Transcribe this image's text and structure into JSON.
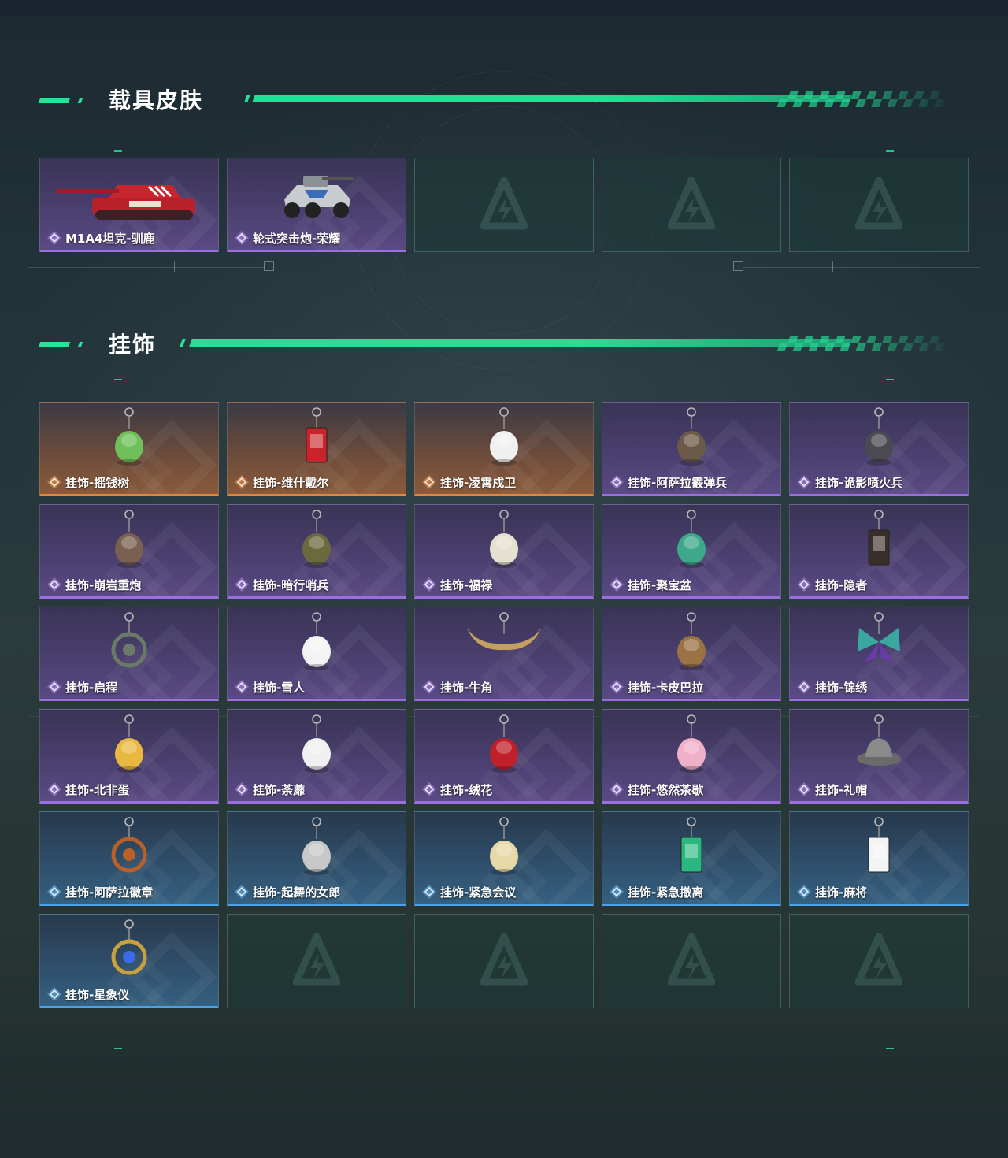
{
  "sections": {
    "vehicle_skins": {
      "title": "载具皮肤",
      "items": [
        {
          "name": "M1A4坦克-驯鹿",
          "rarity": "purple",
          "icon": "tank-icon"
        },
        {
          "name": "轮式突击炮-荣耀",
          "rarity": "purple",
          "icon": "armored-car-icon"
        },
        {
          "name": "",
          "rarity": "empty"
        },
        {
          "name": "",
          "rarity": "empty"
        },
        {
          "name": "",
          "rarity": "empty"
        }
      ]
    },
    "charms": {
      "title": "挂饰",
      "items": [
        {
          "name": "挂饰-摇钱树",
          "rarity": "orange",
          "icon": "money-tree-icon"
        },
        {
          "name": "挂饰-维什戴尔",
          "rarity": "orange",
          "icon": "banner-charm-icon"
        },
        {
          "name": "挂饰-凌霄戍卫",
          "rarity": "orange",
          "icon": "bird-charm-icon"
        },
        {
          "name": "挂饰-阿萨拉霰弹兵",
          "rarity": "purple",
          "icon": "soldier-charm-icon"
        },
        {
          "name": "挂饰-诡影喷火兵",
          "rarity": "purple",
          "icon": "flamethrower-soldier-icon"
        },
        {
          "name": "挂饰-崩岩重炮",
          "rarity": "purple",
          "icon": "heavy-gunner-icon"
        },
        {
          "name": "挂饰-暗行哨兵",
          "rarity": "purple",
          "icon": "sentry-charm-icon"
        },
        {
          "name": "挂饰-福禄",
          "rarity": "purple",
          "icon": "gourd-charm-icon"
        },
        {
          "name": "挂饰-聚宝盆",
          "rarity": "purple",
          "icon": "treasure-bowl-icon"
        },
        {
          "name": "挂饰-隐者",
          "rarity": "purple",
          "icon": "hermit-card-icon"
        },
        {
          "name": "挂饰-启程",
          "rarity": "purple",
          "icon": "compass-badge-icon"
        },
        {
          "name": "挂饰-雪人",
          "rarity": "purple",
          "icon": "snowman-icon"
        },
        {
          "name": "挂饰-牛角",
          "rarity": "purple",
          "icon": "bull-horn-icon"
        },
        {
          "name": "挂饰-卡皮巴拉",
          "rarity": "purple",
          "icon": "capybara-icon"
        },
        {
          "name": "挂饰-锦绣",
          "rarity": "purple",
          "icon": "butterfly-icon"
        },
        {
          "name": "挂饰-北非蛋",
          "rarity": "purple",
          "icon": "shakshuka-icon"
        },
        {
          "name": "挂饰-荼蘼",
          "rarity": "purple",
          "icon": "flower-charm-icon"
        },
        {
          "name": "挂饰-绒花",
          "rarity": "purple",
          "icon": "rose-charm-icon"
        },
        {
          "name": "挂饰-悠然茶歇",
          "rarity": "purple",
          "icon": "cupcake-icon"
        },
        {
          "name": "挂饰-礼帽",
          "rarity": "purple",
          "icon": "fedora-icon"
        },
        {
          "name": "挂饰-阿萨拉徽章",
          "rarity": "blue",
          "icon": "medal-icon"
        },
        {
          "name": "挂饰-起舞的女郎",
          "rarity": "blue",
          "icon": "dancer-icon"
        },
        {
          "name": "挂饰-紧急会议",
          "rarity": "blue",
          "icon": "meeting-charm-icon"
        },
        {
          "name": "挂饰-紧急撤离",
          "rarity": "blue",
          "icon": "evacuation-sign-icon"
        },
        {
          "name": "挂饰-麻将",
          "rarity": "blue",
          "icon": "mahjong-tile-icon"
        },
        {
          "name": "挂饰-星象仪",
          "rarity": "blue",
          "icon": "astrolabe-icon"
        },
        {
          "name": "",
          "rarity": "empty"
        },
        {
          "name": "",
          "rarity": "empty"
        },
        {
          "name": "",
          "rarity": "empty"
        },
        {
          "name": "",
          "rarity": "empty"
        }
      ]
    }
  },
  "colors": {
    "accent": "#27e39a",
    "purple": "#9b6fe0",
    "orange": "#e3853a",
    "blue": "#4aa3e8"
  }
}
